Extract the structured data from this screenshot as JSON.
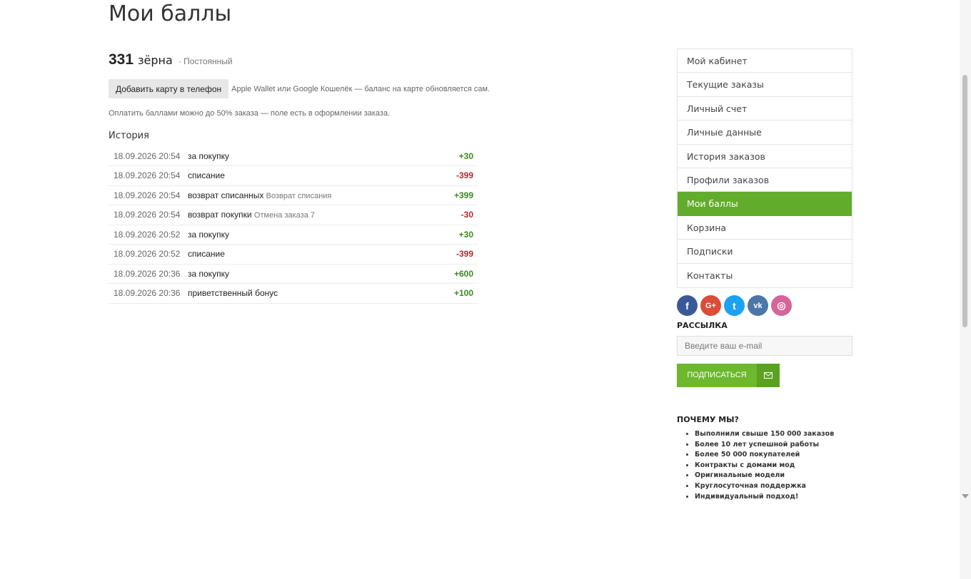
{
  "page": {
    "title": "Мои баллы"
  },
  "balance": {
    "value": "331",
    "unit": "зёрна",
    "status": "· Постоянный"
  },
  "wallet": {
    "button_label": "Добавить карту в телефон",
    "note": "Apple Wallet или Google Кошелёк — баланс на карте обновляется сам."
  },
  "pay_note": "Оплатить баллами можно до 50% заказа — поле есть в оформлении заказа.",
  "history": {
    "title": "История",
    "rows": [
      {
        "date": "18.09.2026 20:54",
        "desc": "за покупку",
        "note": "",
        "amount": "+30",
        "sign": "plus"
      },
      {
        "date": "18.09.2026 20:54",
        "desc": "списание",
        "note": "",
        "amount": "-399",
        "sign": "minus"
      },
      {
        "date": "18.09.2026 20:54",
        "desc": "возврат списанных",
        "note": "Возврат списания",
        "amount": "+399",
        "sign": "plus"
      },
      {
        "date": "18.09.2026 20:54",
        "desc": "возврат покупки",
        "note": "Отмена заказа 7",
        "amount": "-30",
        "sign": "minus"
      },
      {
        "date": "18.09.2026 20:52",
        "desc": "за покупку",
        "note": "",
        "amount": "+30",
        "sign": "plus"
      },
      {
        "date": "18.09.2026 20:52",
        "desc": "списание",
        "note": "",
        "amount": "-399",
        "sign": "minus"
      },
      {
        "date": "18.09.2026 20:36",
        "desc": "за покупку",
        "note": "",
        "amount": "+600",
        "sign": "plus"
      },
      {
        "date": "18.09.2026 20:36",
        "desc": "приветственный бонус",
        "note": "",
        "amount": "+100",
        "sign": "plus"
      }
    ]
  },
  "menu": {
    "items": [
      {
        "label": "Мой кабинет",
        "active": false
      },
      {
        "label": "Текущие заказы",
        "active": false
      },
      {
        "label": "Личный счет",
        "active": false
      },
      {
        "label": "Личные данные",
        "active": false
      },
      {
        "label": "История заказов",
        "active": false
      },
      {
        "label": "Профили заказов",
        "active": false
      },
      {
        "label": "Мои баллы",
        "active": true
      },
      {
        "label": "Корзина",
        "active": false
      },
      {
        "label": "Подписки",
        "active": false
      },
      {
        "label": "Контакты",
        "active": false
      }
    ]
  },
  "social": [
    {
      "name": "facebook-icon",
      "glyph": "f",
      "color": "#3b5998"
    },
    {
      "name": "google-plus-icon",
      "glyph": "G+",
      "color": "#dd4b39"
    },
    {
      "name": "twitter-icon",
      "glyph": "t",
      "color": "#1da1f2"
    },
    {
      "name": "vk-icon",
      "glyph": "vk",
      "color": "#4a76a8"
    },
    {
      "name": "instagram-icon",
      "glyph": "◎",
      "color": "#d6649a"
    }
  ],
  "newsletter": {
    "title": "РАССЫЛКА",
    "placeholder": "Введите ваш e-mail",
    "button_label": "ПОДПИСАТЬСЯ"
  },
  "why": {
    "title": "ПОЧЕМУ МЫ?",
    "items": [
      "Выполнили свыше 150 000 заказов",
      "Более 10 лет успешной работы",
      "Более 50 000 покупателей",
      "Контракты с домами мод",
      "Оригинальные модели",
      "Круглосуточная поддержка",
      "Индивидуальный подход!"
    ]
  },
  "colors": {
    "accent": "#62ac2b",
    "plus": "#3a8a1e",
    "minus": "#b52a2a"
  }
}
